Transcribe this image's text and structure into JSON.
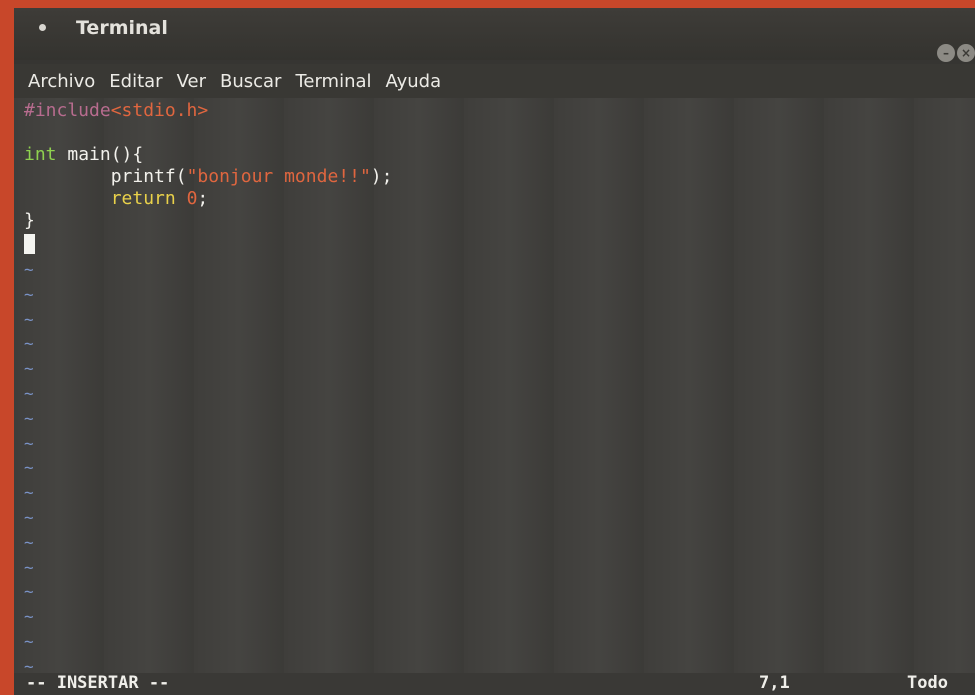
{
  "window": {
    "title": "Terminal",
    "controls": [
      "–",
      "×"
    ]
  },
  "menubar": {
    "items": [
      "Archivo",
      "Editar",
      "Ver",
      "Buscar",
      "Terminal",
      "Ayuda"
    ]
  },
  "editor": {
    "lines": [
      {
        "parts": [
          {
            "text": "#include",
            "kind": "pre"
          },
          {
            "text": "<stdio.h>",
            "kind": "hdr"
          }
        ]
      },
      {
        "parts": []
      },
      {
        "parts": [
          {
            "text": "int",
            "kind": "type"
          },
          {
            "text": " main(){",
            "kind": "plain"
          }
        ]
      },
      {
        "parts": [
          {
            "text": "        printf(",
            "kind": "plain"
          },
          {
            "text": "\"bonjour monde!!\"",
            "kind": "str"
          },
          {
            "text": ");",
            "kind": "plain"
          }
        ]
      },
      {
        "parts": [
          {
            "text": "        ",
            "kind": "plain"
          },
          {
            "text": "return",
            "kind": "kw"
          },
          {
            "text": " ",
            "kind": "plain"
          },
          {
            "text": "0",
            "kind": "num"
          },
          {
            "text": ";",
            "kind": "plain"
          }
        ]
      },
      {
        "parts": [
          {
            "text": "}",
            "kind": "plain"
          }
        ]
      }
    ],
    "tilde_char": "~",
    "tilde_count": 17
  },
  "status": {
    "mode": "-- INSERTAR --",
    "position": "7,1",
    "scroll": "Todo"
  },
  "colors": {
    "background": "#c8472a",
    "terminal_bg": "#3f3e3b",
    "preprocessor": "#b86c8f",
    "string": "#e0663f",
    "type": "#8fd14f",
    "keyword": "#e9d14a",
    "tilde": "#7a93c7"
  }
}
